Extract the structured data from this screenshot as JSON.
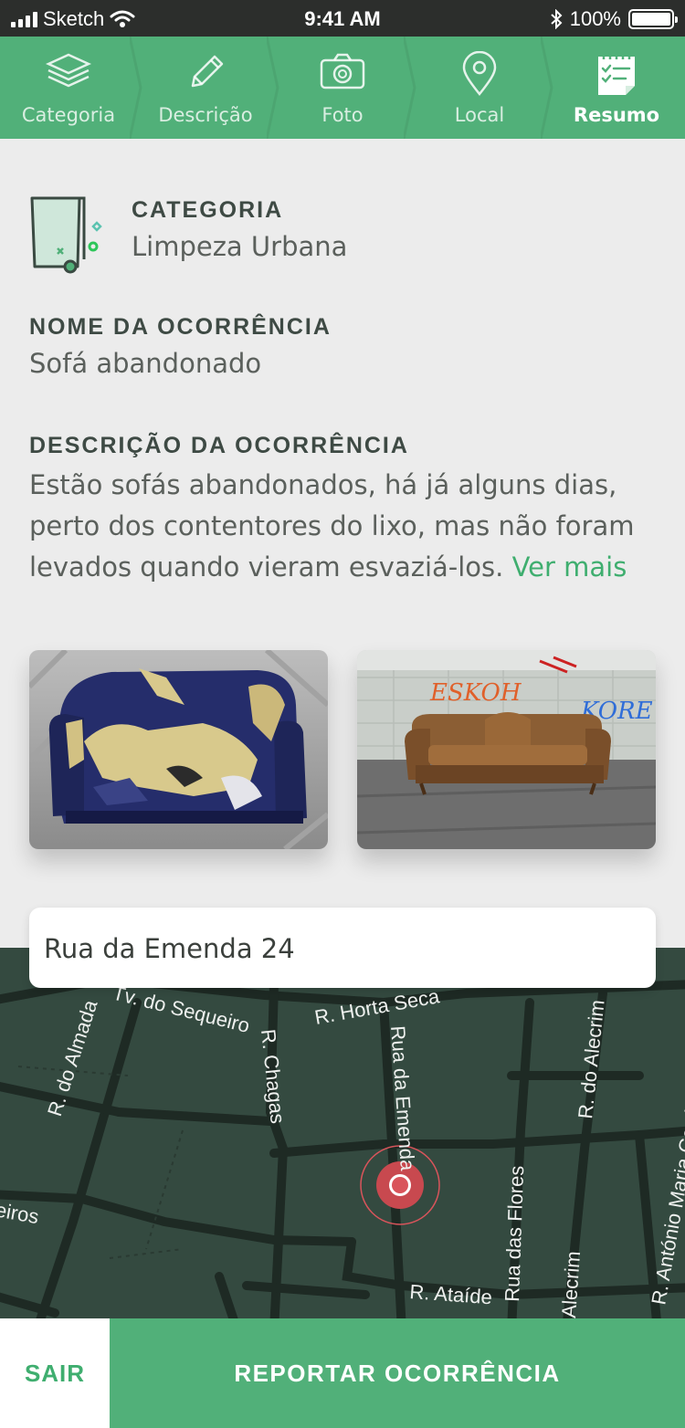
{
  "status_bar": {
    "carrier": "Sketch",
    "time": "9:41 AM",
    "battery": "100%"
  },
  "steps": [
    {
      "label": "Categoria",
      "icon": "layers-icon"
    },
    {
      "label": "Descrição",
      "icon": "pencil-icon"
    },
    {
      "label": "Foto",
      "icon": "camera-icon"
    },
    {
      "label": "Local",
      "icon": "location-pin-icon"
    },
    {
      "label": "Resumo",
      "icon": "checklist-icon",
      "active": true
    }
  ],
  "summary": {
    "category_label": "CATEGORIA",
    "category_value": "Limpeza Urbana",
    "name_label": "NOME DA OCORRÊNCIA",
    "name_value": "Sofá abandonado",
    "description_label": "DESCRIÇÃO DA OCORRÊNCIA",
    "description_value": "Estão sofás abandonados, há já alguns dias, perto dos contentores do lixo, mas não foram levados quando vieram esvaziá-los.",
    "more_link": "Ver mais"
  },
  "photos": [
    {
      "name": "photo-torn-sofa"
    },
    {
      "name": "photo-brown-sofa",
      "graffiti": [
        "ESKOH",
        "KORE"
      ]
    }
  ],
  "location": {
    "address": "Rua da Emenda 24",
    "streets": [
      "Tv. do Sequeiro",
      "R. Horta Seca",
      "R. do Almada",
      "R. Chagas",
      "Rua da Emenda",
      "R. do Alecrim",
      "R. António Maria Cardoso",
      "Rua das Flores",
      "Alecrim",
      "R. Ataíde",
      "eiros"
    ]
  },
  "actions": {
    "exit": "SAIR",
    "report": "REPORTAR OCORRÊNCIA"
  },
  "colors": {
    "brand_green": "#51b079",
    "link_green": "#3fae6f",
    "map_bg": "#344a40",
    "pin_red": "#d9545b"
  }
}
